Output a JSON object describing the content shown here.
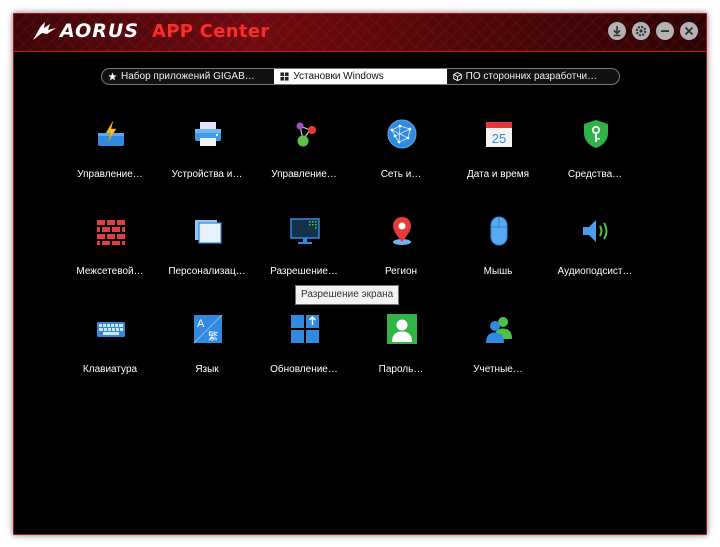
{
  "titlebar": {
    "brand": "AORUS",
    "app_title": "APP Center",
    "controls": [
      "download-icon",
      "gear-icon",
      "minimize-icon",
      "close-icon"
    ]
  },
  "tabs": [
    {
      "label": "Набор приложений GIGAB…",
      "icon": "star-icon",
      "active": false
    },
    {
      "label": "Установки Windows",
      "icon": "windows-icon",
      "active": true
    },
    {
      "label": "ПО сторонних разработчи…",
      "icon": "cube-icon",
      "active": false
    }
  ],
  "items": [
    {
      "label": "Управление…",
      "icon": "power-options-icon"
    },
    {
      "label": "Устройства и…",
      "icon": "printer-icon"
    },
    {
      "label": "Управление…",
      "icon": "default-programs-icon"
    },
    {
      "label": "Сеть и…",
      "icon": "network-globe-icon"
    },
    {
      "label": "Дата и время",
      "icon": "calendar-icon"
    },
    {
      "label": "Средства…",
      "icon": "security-shield-icon"
    },
    {
      "label": "Межсетевой…",
      "icon": "firewall-icon"
    },
    {
      "label": "Персонализац…",
      "icon": "personalization-icon"
    },
    {
      "label": "Разрешение…",
      "icon": "display-resolution-icon"
    },
    {
      "label": "Регион",
      "icon": "region-pin-icon"
    },
    {
      "label": "Мышь",
      "icon": "mouse-icon"
    },
    {
      "label": "Аудиоподсист…",
      "icon": "speaker-icon"
    },
    {
      "label": "Клавиатура",
      "icon": "keyboard-icon"
    },
    {
      "label": "Язык",
      "icon": "language-icon"
    },
    {
      "label": "Обновление…",
      "icon": "windows-update-icon"
    },
    {
      "label": "Пароль…",
      "icon": "password-user-icon"
    },
    {
      "label": "Учетные…",
      "icon": "user-accounts-icon"
    }
  ],
  "tooltip": "Разрешение экрана",
  "colors": {
    "accent_red": "#ff2a2a",
    "window_bg": "#000000",
    "icon_blue": "#2f8ae0"
  }
}
